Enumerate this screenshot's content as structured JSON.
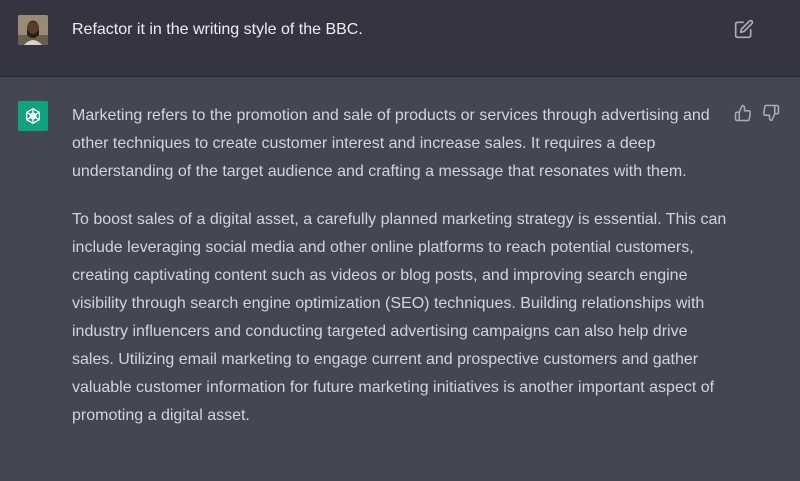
{
  "user_message": {
    "text": "Refactor it in the writing style of the BBC.",
    "avatar_icon": "user-avatar-photo",
    "edit_icon": "edit-icon"
  },
  "assistant_message": {
    "avatar_icon": "chatgpt-logo-icon",
    "avatar_color": "#10a37f",
    "paragraphs": [
      "Marketing refers to the promotion and sale of products or services through advertising and other techniques to create customer interest and increase sales. It requires a deep understanding of the target audience and crafting a message that resonates with them.",
      "To boost sales of a digital asset, a carefully planned marketing strategy is essential. This can include leveraging social media and other online platforms to reach potential customers, creating captivating content such as videos or blog posts, and improving search engine visibility through search engine optimization (SEO) techniques. Building relationships with industry influencers and conducting targeted advertising campaigns can also help drive sales. Utilizing email marketing to engage current and prospective customers and gather valuable customer information for future marketing initiatives is another important aspect of promoting a digital asset."
    ],
    "feedback_icons": [
      "thumbs-up-icon",
      "thumbs-down-icon"
    ]
  },
  "colors": {
    "user_row_bg": "#343541",
    "assistant_row_bg": "#444654",
    "text": "#d1d5db"
  }
}
